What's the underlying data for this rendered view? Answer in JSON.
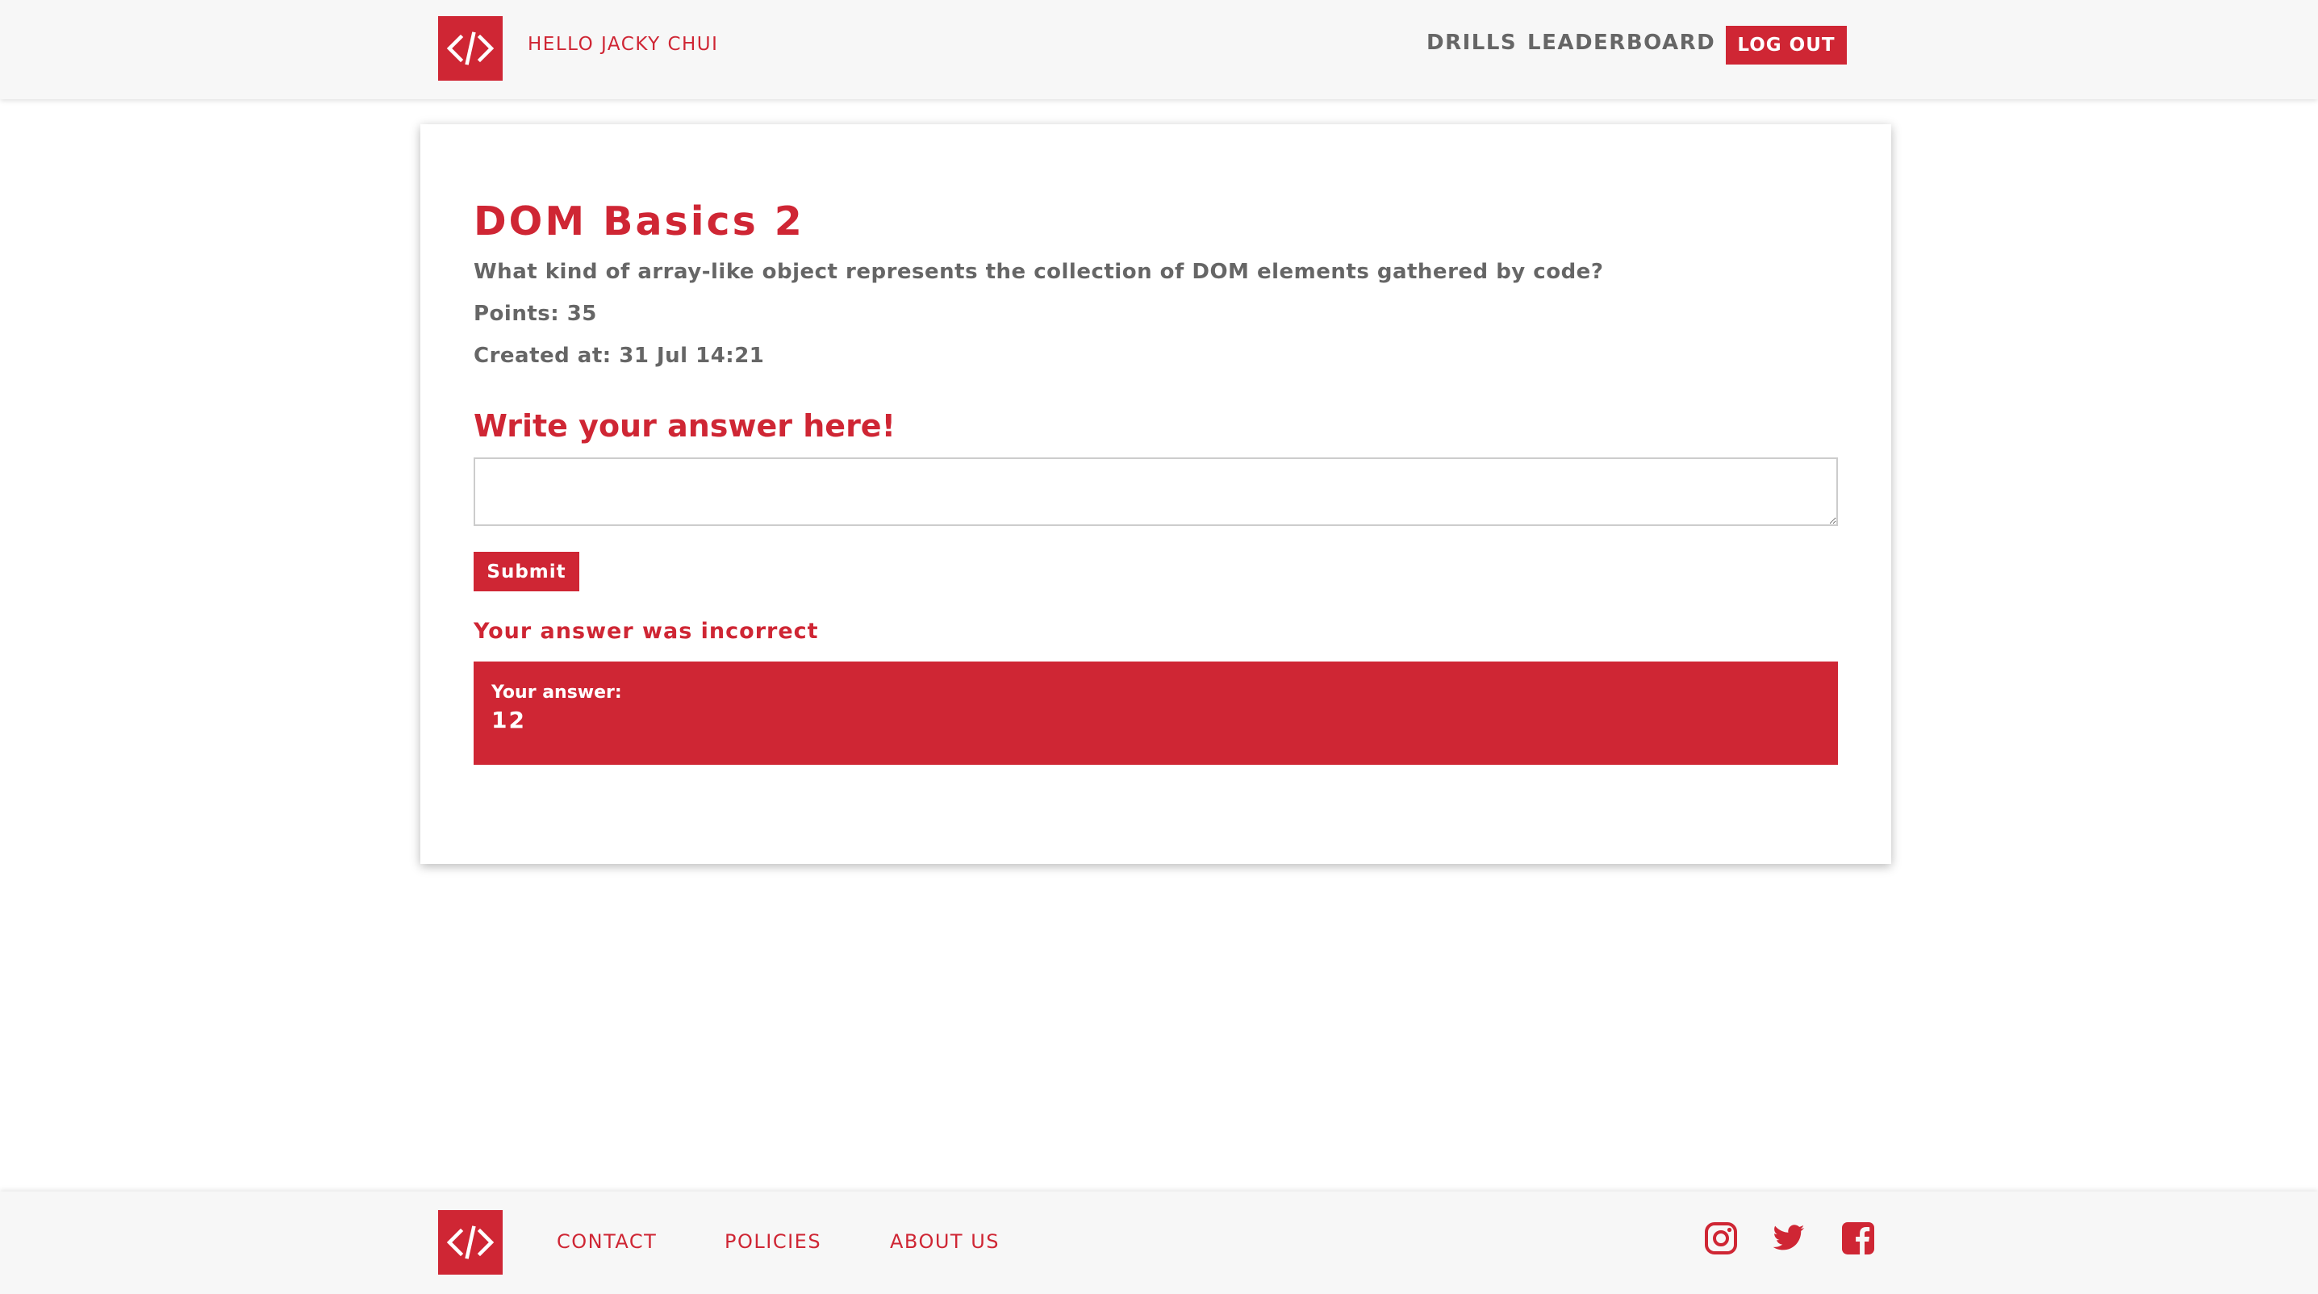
{
  "header": {
    "greeting": "HELLO JACKY CHUI",
    "nav": {
      "drills": "DRILLS",
      "leaderboard": "LEADERBOARD",
      "logout": "LOG OUT"
    },
    "logo_icon": "code-brackets-icon"
  },
  "drill": {
    "title": "DOM Basics 2",
    "question": "What kind of array-like object represents the collection of DOM elements gathered by code?",
    "points": "Points: 35",
    "created_at": "Created at: 31 Jul 14:21"
  },
  "answer_form": {
    "heading": "Write your answer here!",
    "input_value": "",
    "input_placeholder": "",
    "submit_label": "Submit"
  },
  "result": {
    "message": "Your answer was incorrect",
    "your_answer_label": "Your answer:",
    "your_answer_value": "12"
  },
  "footer": {
    "links": {
      "contact": "CONTACT",
      "policies": "POLICIES",
      "about": "ABOUT US"
    },
    "social_icons": [
      "instagram-icon",
      "twitter-icon",
      "facebook-icon"
    ]
  },
  "colors": {
    "brand_red": "#cf2634",
    "text_gray": "#666666",
    "bar_background": "#f7f7f7"
  }
}
